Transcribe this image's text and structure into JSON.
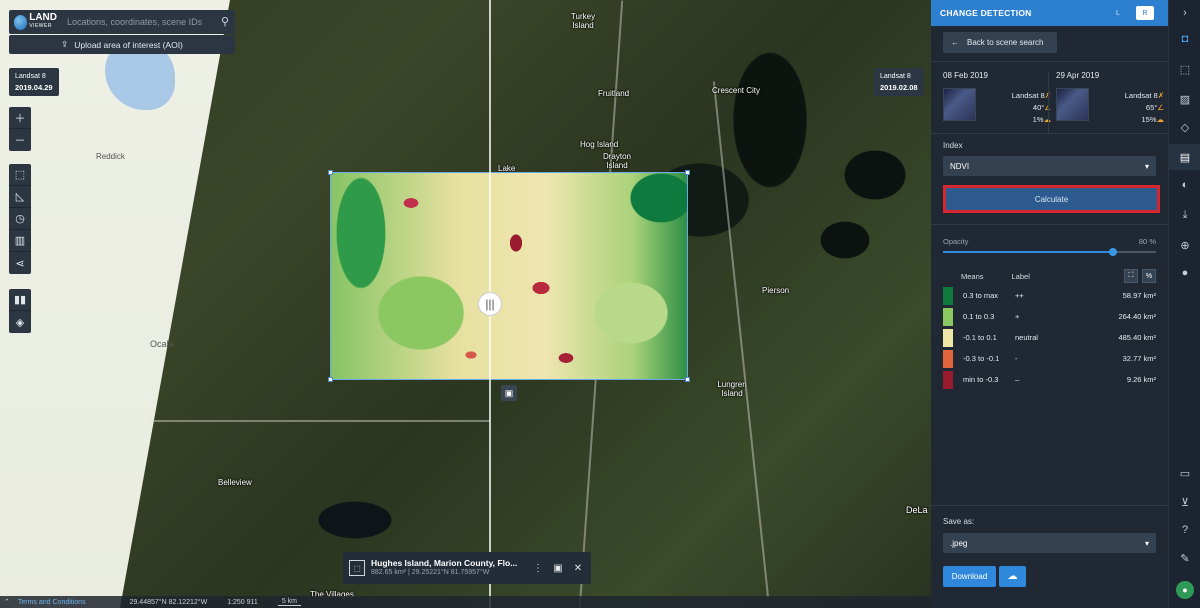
{
  "map": {
    "labels": {
      "reddick": "Reddick",
      "ocala": "Ocala",
      "belleview": "Belleview",
      "turkey_island": "Turkey Island",
      "fruitland": "Fruitland",
      "crescent_city": "Crescent City",
      "hog_island": "Hog Island",
      "drayton_island": "Drayton Island",
      "lake": "Lake",
      "pierson": "Pierson",
      "lungren_island": "Lungren Island",
      "the_villages": "The Villages",
      "deland": "DeLa"
    },
    "search": {
      "placeholder": "Locations, coordinates, scene IDs"
    },
    "logo": {
      "name": "LAND",
      "sub": "VIEWER"
    },
    "upload_aoi_label": "Upload area of interest (AOI)",
    "left_scene": {
      "sensor": "Landsat 8",
      "date": "2019.04.29"
    },
    "right_scene": {
      "sensor": "Landsat 8",
      "date": "2019.02.08"
    },
    "aoi_info": {
      "title": "Hughes Island, Marion County, Flo...",
      "subtitle": "882.65 km² | 29.25221°N 81.75957°W"
    },
    "status": {
      "terms": "Terms and Conditions",
      "coords": "29.44857°N 82.12212°W",
      "scale": "1:250 911",
      "scale_bar": "5 km"
    }
  },
  "panel": {
    "title": "CHANGE DETECTION",
    "left_toggle": "L",
    "right_toggle": "R",
    "back_label": "Back to scene search",
    "scenes": [
      {
        "date": "08 Feb 2019",
        "sensor": "Landsat 8",
        "sun": "40°",
        "cloud": "1%"
      },
      {
        "date": "29 Apr 2019",
        "sensor": "Landsat 8",
        "sun": "65°",
        "cloud": "15%"
      }
    ],
    "index_label": "Index",
    "index_value": "NDVI",
    "calculate_label": "Calculate",
    "opacity_label": "Opacity",
    "opacity_value": "80 %",
    "opacity_fraction": 0.8,
    "legend": {
      "means_header": "Means",
      "label_header": "Label",
      "percent_toggle": "%",
      "rows": [
        {
          "range": "0.3 to max",
          "label": "++",
          "area": "58.97 km²",
          "color": "#0f7a3e"
        },
        {
          "range": "0.1 to 0.3",
          "label": "+",
          "area": "264.40 km²",
          "color": "#8cc862"
        },
        {
          "range": "-0.1 to 0.1",
          "label": "neutral",
          "area": "485.40 km²",
          "color": "#efe6a6"
        },
        {
          "range": "-0.3 to -0.1",
          "label": "-",
          "area": "32.77 km²",
          "color": "#e0643c"
        },
        {
          "range": "min to -0.3",
          "label": "–",
          "area": "9.26 km²",
          "color": "#9a1b30"
        }
      ]
    },
    "save_as_label": "Save as:",
    "save_format": ".jpeg",
    "download_label": "Download"
  }
}
